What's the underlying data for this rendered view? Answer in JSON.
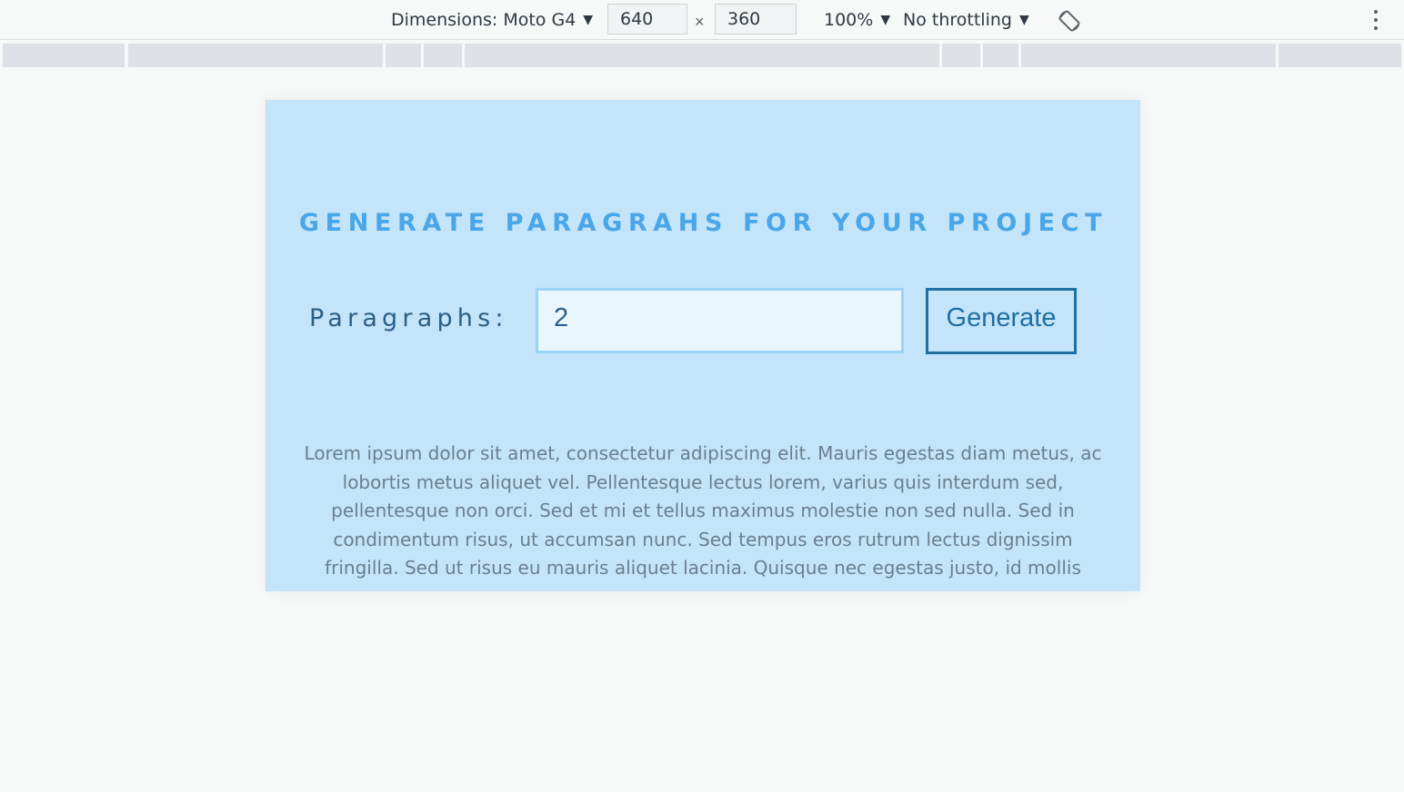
{
  "devtools": {
    "dimensions_label": "Dimensions: Moto G4",
    "width_value": "640",
    "times_symbol": "×",
    "height_value": "360",
    "zoom_label": "100%",
    "throttling_label": "No throttling",
    "caret": "▼"
  },
  "page": {
    "title": "GENERATE PARAGRAHS FOR YOUR PROJECT",
    "form_label": "Paragraphs:",
    "amount_value": "2",
    "generate_label": "Generate",
    "paragraph": "Lorem ipsum dolor sit amet, consectetur adipiscing elit. Mauris egestas diam metus, ac lobortis metus aliquet vel. Pellentesque lectus lorem, varius quis interdum sed, pellentesque non orci. Sed et mi et tellus maximus molestie non sed nulla. Sed in condimentum risus, ut accumsan nunc. Sed tempus eros rutrum lectus dignissim fringilla. Sed ut risus eu mauris aliquet lacinia. Quisque nec egestas justo, id mollis arcu."
  },
  "colors": {
    "page_background": "#c4e4f9",
    "title": "#49a6e9",
    "button": "#1f6fa3",
    "input_border": "#9cd4f5"
  },
  "icons": {
    "rotate": "rotate-icon",
    "more": "more-vertical-icon"
  }
}
